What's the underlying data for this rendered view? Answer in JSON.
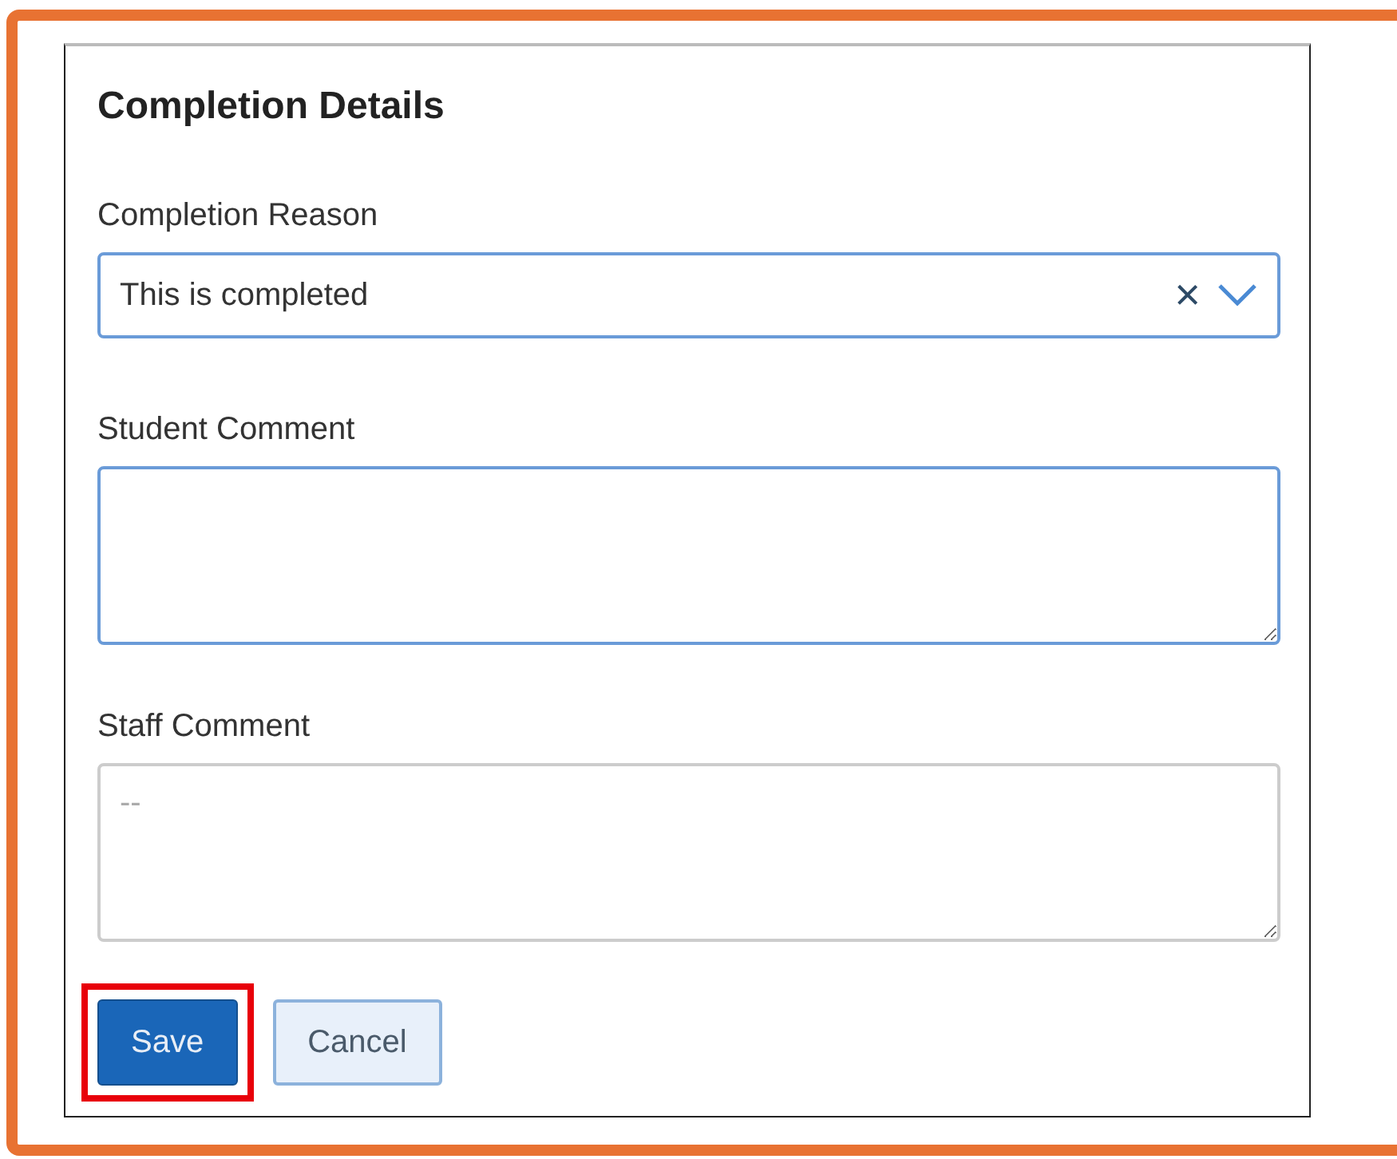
{
  "title": "Completion Details",
  "reason": {
    "label": "Completion Reason",
    "value": "This is completed",
    "clear": "×"
  },
  "comments": [
    {
      "label": "Student Comment",
      "disabled": false
    },
    {
      "label": "Staff Comment",
      "placeholder": "--",
      "disabled": true
    }
  ],
  "buttons": [
    {
      "label": "Save",
      "kind": "primary",
      "highlighted": true
    },
    {
      "label": "Cancel",
      "kind": "secondary",
      "highlighted": false
    }
  ]
}
